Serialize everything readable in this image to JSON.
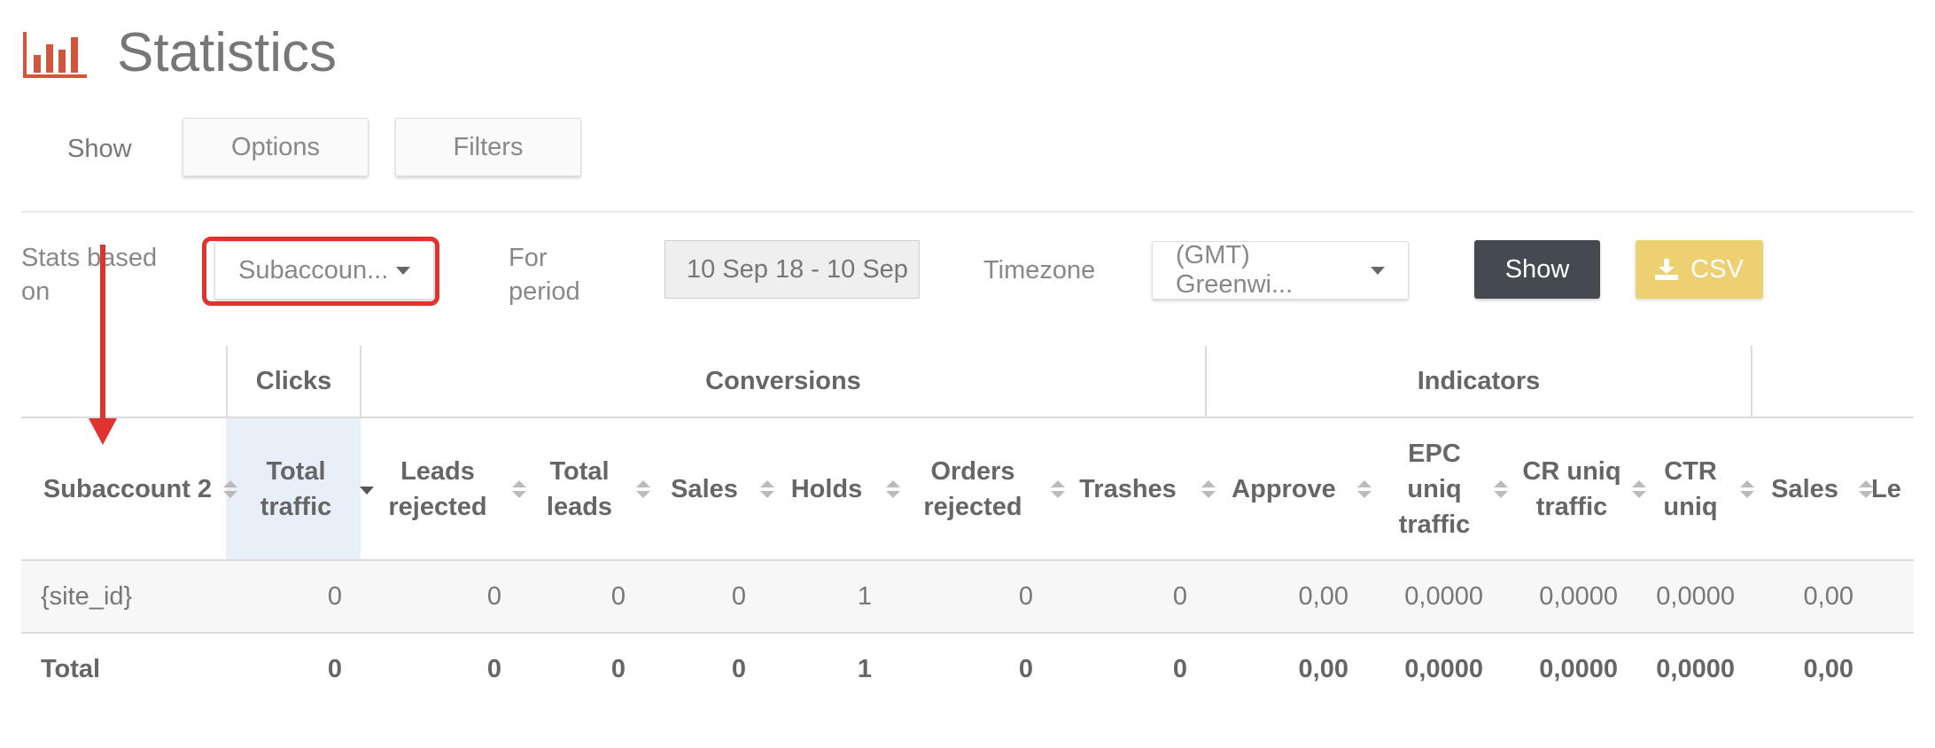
{
  "page": {
    "title": "Statistics"
  },
  "icons": {
    "logo": "bar-chart-icon",
    "csv": "download-icon",
    "sort": "sort-icon",
    "sort_desc": "caret-down-icon",
    "dropdown": "caret-down-icon"
  },
  "colors": {
    "accent": "#d0553a",
    "highlight": "#e0332e",
    "show_button": "#444a4f",
    "csv_button": "#edd071",
    "sorted_column": "#e8eff8"
  },
  "toolbar": {
    "show_label": "Show",
    "options_label": "Options",
    "filters_label": "Filters"
  },
  "controls": {
    "stats_based_on_label": "Stats based on",
    "stats_based_on_value": "Subaccoun...",
    "for_period_label": "For period",
    "period_value": "10 Sep 18 - 10 Sep",
    "timezone_label": "Timezone",
    "timezone_value": "(GMT) Greenwi...",
    "show_button": "Show",
    "csv_button": "CSV"
  },
  "table": {
    "groups": {
      "clicks": "Clicks",
      "conversions": "Conversions",
      "indicators": "Indicators"
    },
    "columns": [
      "Subaccount 2",
      "Total traffic",
      "Leads rejected",
      "Total leads",
      "Sales",
      "Holds",
      "Orders rejected",
      "Trashes",
      "Approve",
      "EPC uniq traffic",
      "CR uniq traffic",
      "CTR uniq",
      "Sales",
      "Le"
    ],
    "rows": [
      [
        "{site_id}",
        "0",
        "0",
        "0",
        "0",
        "1",
        "0",
        "0",
        "0,00",
        "0,0000",
        "0,0000",
        "0,0000",
        "0,00"
      ]
    ],
    "total": [
      "Total",
      "0",
      "0",
      "0",
      "0",
      "1",
      "0",
      "0",
      "0,00",
      "0,0000",
      "0,0000",
      "0,0000",
      "0,00"
    ]
  }
}
